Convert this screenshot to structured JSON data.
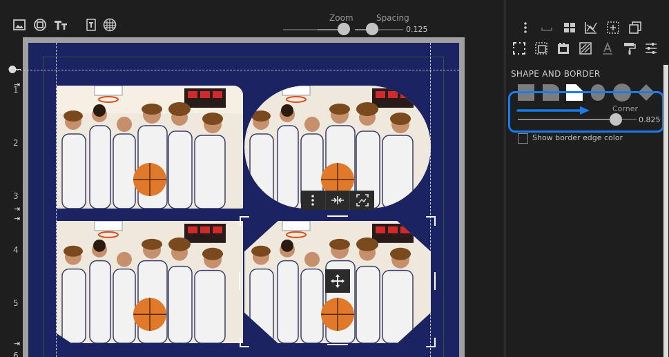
{
  "toolbar": {
    "left_icons": [
      "image-icon",
      "shape-icon",
      "text-icon",
      "text-frame-icon",
      "grid-icon"
    ],
    "zoom_label": "Zoom",
    "zoom_value": 0.5,
    "spacing_label": "Spacing",
    "spacing_value": "0.125"
  },
  "ruler": {
    "marks": [
      "1",
      "2",
      "3",
      "4",
      "5",
      "6"
    ]
  },
  "context_toolbar": {
    "icons": [
      "more-vertical-icon",
      "fit-inward-icon",
      "crop-frame-icon"
    ]
  },
  "move_handle": {
    "icon": "move-arrows-icon"
  },
  "panel": {
    "row1_icons": [
      "more-vertical-icon",
      "blank-frame-icon",
      "layout-icon",
      "chart-icon",
      "dotted-grid-icon",
      "copy-pages-icon"
    ],
    "row2_icons": [
      "frame-select-icon",
      "frame-dotted-icon",
      "film-strip-icon",
      "pattern-icon",
      "text-color-icon",
      "paint-roller-icon",
      "sliders-icon"
    ],
    "section_title": "SHAPE AND BORDER",
    "shapes": [
      "rectangle-shape-icon",
      "rounded-right-shape-icon",
      "folded-corner-shape-icon",
      "pill-shape-icon",
      "circle-shape-icon",
      "diamond-shape-icon"
    ],
    "corner_label": "Corner",
    "corner_value": "0.825",
    "corner_fraction": 0.825,
    "checkbox_label": "Show border edge color",
    "checkbox_checked": false,
    "highlight_color": "#1a7cf0"
  },
  "colors": {
    "page_background": "#1c2363",
    "app_background": "#1e1e1e",
    "accent": "#1a7cf0"
  }
}
